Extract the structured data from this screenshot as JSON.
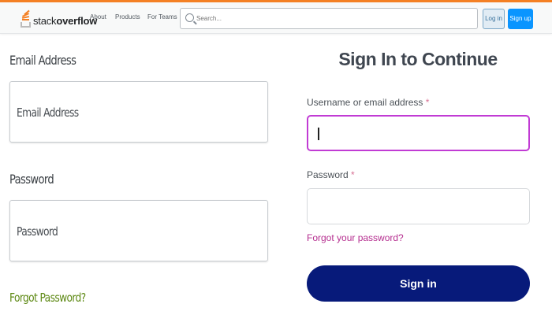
{
  "header": {
    "logo_text_light": "stack",
    "logo_text_bold": "overflow",
    "nav": [
      "About",
      "Products",
      "For Teams"
    ],
    "search_placeholder": "Search...",
    "login_label": "Log in",
    "signup_label": "Sign up",
    "accent_color": "#f48024"
  },
  "left_form": {
    "email_label": "Email Address",
    "email_placeholder": "Email Address",
    "password_label": "Password",
    "password_placeholder": "Password",
    "forgot_label": "Forgot Password?"
  },
  "right_form": {
    "title": "Sign In to Continue",
    "username_label": "Username or email address",
    "required_mark": "*",
    "username_value": "",
    "password_label": "Password",
    "forgot_label": "Forgot your password?",
    "signin_label": "Sign in",
    "focus_color": "#c13bd4",
    "button_color": "#071a7a"
  }
}
